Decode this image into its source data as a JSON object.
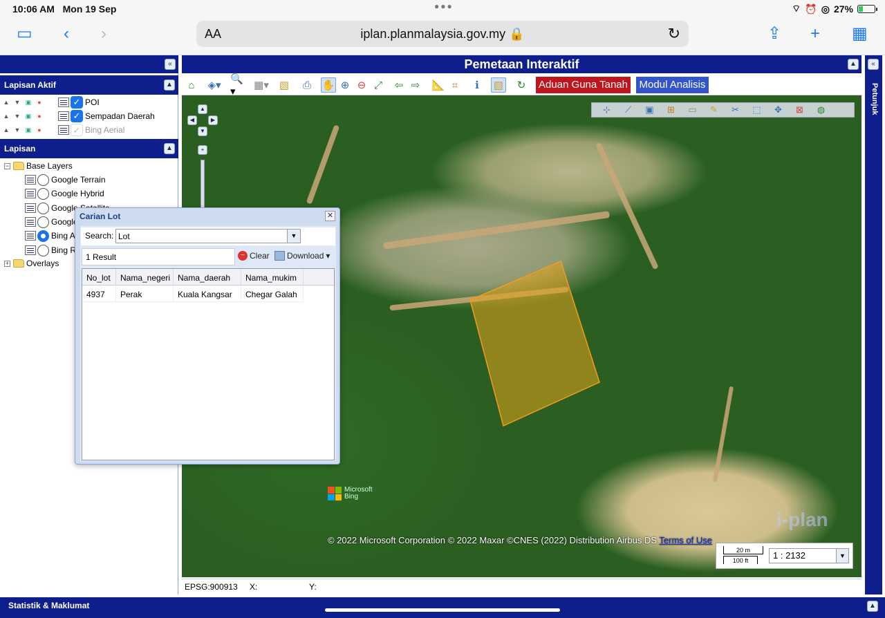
{
  "status": {
    "time": "10:06 AM",
    "date": "Mon 19 Sep",
    "battery": "27%"
  },
  "browser": {
    "aa": "AA",
    "url": "iplan.planmalaysia.gov.my"
  },
  "left_panel": {
    "active_title": "Lapisan Aktif",
    "active_layers": [
      "POI",
      "Sempadan Daerah",
      "Bing Aerial"
    ],
    "layers_title": "Lapisan",
    "base_layers_label": "Base Layers",
    "base_layers": [
      "Google Terrain",
      "Google Hybrid",
      "Google Satellite",
      "Google Streets",
      "Bing Aerial",
      "Bing Road"
    ],
    "base_layers_visible": [
      "Google Terrain",
      "Google Hybrid",
      "Google Satellite",
      "Google",
      "Bing A",
      "Bing R"
    ],
    "overlays_label": "Overlays"
  },
  "main": {
    "title": "Pemetaan Interaktif",
    "aduan_label": "Aduan Guna Tanah",
    "modul_label": "Modul Analisis",
    "copyright": "© 2022 Microsoft Corporation © 2022 Maxar ©CNES (2022) Distribution Airbus DS",
    "terms": "Terms of Use",
    "bing_line1": "Microsoft",
    "bing_line2": "Bing",
    "watermark": "i-plan",
    "scale_20m": "20 m",
    "scale_100ft": "100 ft",
    "scale_value": "1 : 2132",
    "epsg": "EPSG:900913",
    "x_label": "X:",
    "y_label": "Y:"
  },
  "right_rail": {
    "label": "Petunjuk"
  },
  "bottom": {
    "label": "Statistik & Maklumat"
  },
  "dialog": {
    "title": "Carian Lot",
    "search_label": "Search:",
    "search_value": "Lot",
    "result_count": "1 Result",
    "clear_label": "Clear",
    "download_label": "Download",
    "columns": [
      "No_lot",
      "Nama_negeri",
      "Nama_daerah",
      "Nama_mukim"
    ],
    "rows": [
      [
        "4937",
        "Perak",
        "Kuala Kangsar",
        "Chegar Galah"
      ]
    ]
  },
  "colors": {
    "navy": "#0e1e8c",
    "aduan": "#c0151f",
    "modul": "#3355cc",
    "parcel": "#e3a21a"
  }
}
